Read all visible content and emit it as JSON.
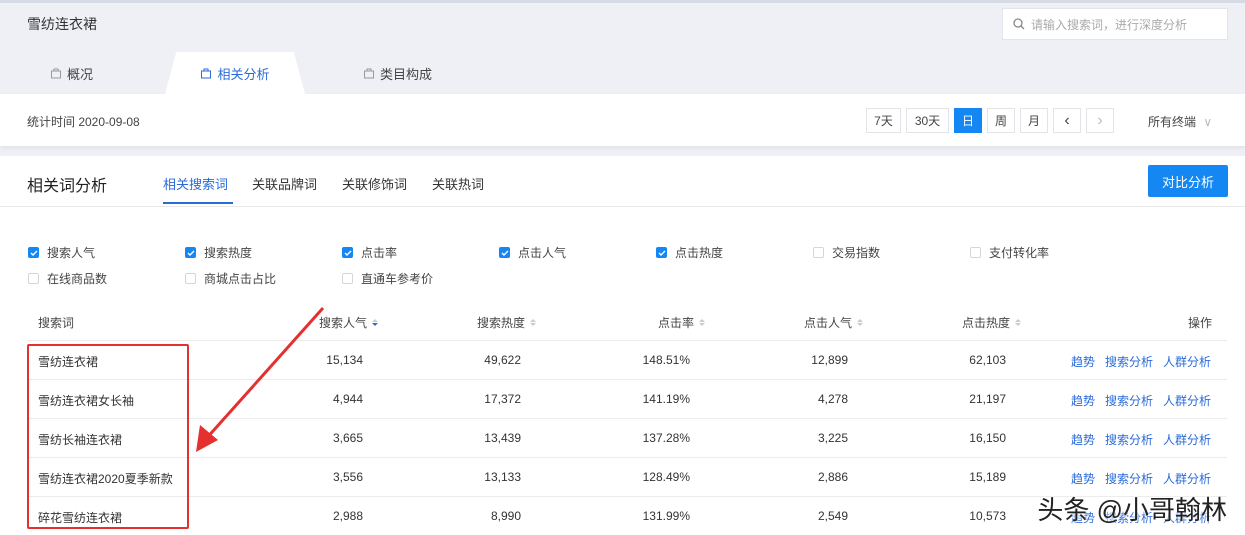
{
  "header": {
    "title": "雪纺连衣裙",
    "search_placeholder": "请输入搜索词，进行深度分析"
  },
  "tabs": [
    {
      "label": "概况"
    },
    {
      "label": "相关分析",
      "active": true
    },
    {
      "label": "类目构成"
    }
  ],
  "filter": {
    "stat_time": "统计时间 2020-09-08",
    "ranges": [
      "7天",
      "30天",
      "日",
      "周",
      "月"
    ],
    "selected": "日",
    "prev": "‹",
    "next": "›",
    "terminal": "所有终端"
  },
  "panel": {
    "title": "相关词分析",
    "subtabs": [
      "相关搜索词",
      "关联品牌词",
      "关联修饰词",
      "关联热词"
    ],
    "compare": "对比分析"
  },
  "checkboxes": [
    {
      "label": "搜索人气",
      "checked": true
    },
    {
      "label": "搜索热度",
      "checked": true
    },
    {
      "label": "点击率",
      "checked": true
    },
    {
      "label": "点击人气",
      "checked": true
    },
    {
      "label": "点击热度",
      "checked": true
    },
    {
      "label": "交易指数",
      "checked": false
    },
    {
      "label": "支付转化率",
      "checked": false
    },
    {
      "label": "在线商品数",
      "checked": false
    },
    {
      "label": "商城点击占比",
      "checked": false
    },
    {
      "label": "直通车参考价",
      "checked": false
    }
  ],
  "table": {
    "headers": [
      "搜索词",
      "搜索人气",
      "搜索热度",
      "点击率",
      "点击人气",
      "点击热度",
      "操作"
    ],
    "rows": [
      [
        "雪纺连衣裙",
        "15,134",
        "49,622",
        "148.51%",
        "12,899",
        "62,103"
      ],
      [
        "雪纺连衣裙女长袖",
        "4,944",
        "17,372",
        "141.19%",
        "4,278",
        "21,197"
      ],
      [
        "雪纺长袖连衣裙",
        "3,665",
        "13,439",
        "137.28%",
        "3,225",
        "16,150"
      ],
      [
        "雪纺连衣裙2020夏季新款",
        "3,556",
        "13,133",
        "128.49%",
        "2,886",
        "15,189"
      ],
      [
        "碎花雪纺连衣裙",
        "2,988",
        "8,990",
        "131.99%",
        "2,549",
        "10,573"
      ]
    ],
    "actions": [
      "趋势",
      "搜索分析",
      "人群分析"
    ]
  },
  "colors": {
    "accent": "#1487f2",
    "link": "#2a6bd9",
    "highlight": "#e53030"
  },
  "watermark": "头条 @小哥翰林"
}
